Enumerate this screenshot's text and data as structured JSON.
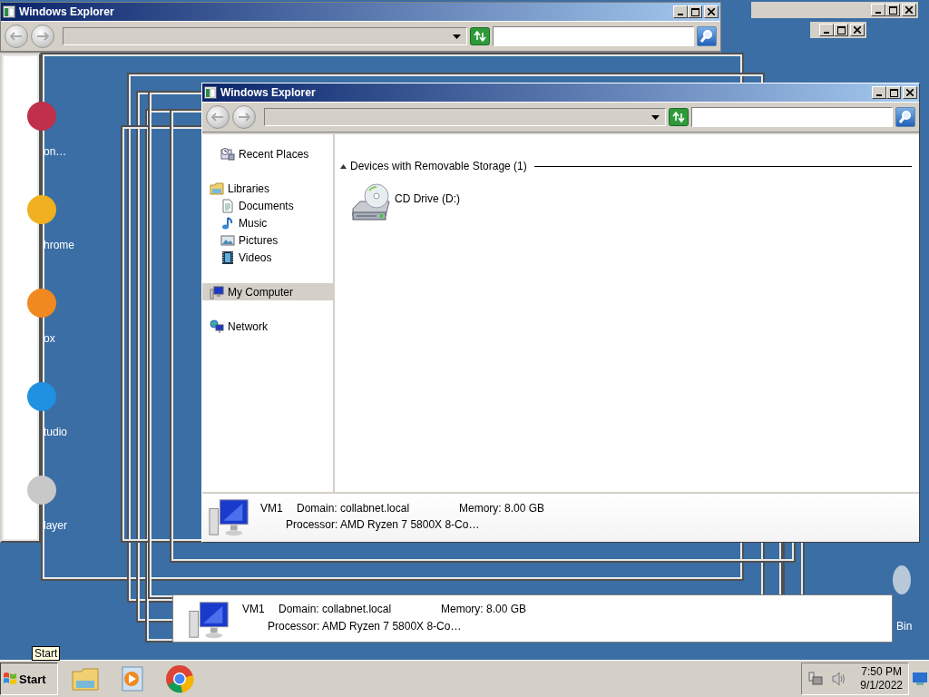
{
  "desktop_icons": [
    {
      "label": "on…",
      "kind": "app"
    },
    {
      "label": "hrome",
      "kind": "chrome"
    },
    {
      "label": "ox",
      "kind": "firefox"
    },
    {
      "label": "tudio",
      "kind": "studio"
    },
    {
      "label": "layer",
      "kind": "player"
    },
    {
      "label": "Bin",
      "kind": "bin"
    }
  ],
  "back_window": {
    "title": "Windows Explorer"
  },
  "ghost_details": {
    "name": "VM1",
    "domain": "Domain: collabnet.local",
    "memory": "Memory: 8.00 GB",
    "processor": "Processor: AMD Ryzen 7 5800X 8-Co…"
  },
  "window": {
    "title": "Windows Explorer",
    "sidebar": {
      "items": [
        {
          "label": "Recent Places",
          "kind": "recent",
          "selected": false
        },
        {
          "label": "Libraries",
          "kind": "libraries",
          "selected": false,
          "children": [
            {
              "label": "Documents",
              "kind": "documents",
              "selected": false
            },
            {
              "label": "Music",
              "kind": "music",
              "selected": false
            },
            {
              "label": "Pictures",
              "kind": "pictures",
              "selected": false
            },
            {
              "label": "Videos",
              "kind": "videos",
              "selected": false
            }
          ]
        },
        {
          "label": "My Computer",
          "kind": "computer",
          "selected": true
        },
        {
          "label": "Network",
          "kind": "network",
          "selected": false
        }
      ]
    },
    "content": {
      "group": "Devices with Removable Storage (1)",
      "expanded": true,
      "items": [
        {
          "label": "CD Drive (D:)",
          "kind": "cd"
        }
      ]
    },
    "details": {
      "name": "VM1",
      "domain": "Domain: collabnet.local",
      "memory": "Memory: 8.00 GB",
      "processor": "Processor: AMD Ryzen 7 5800X 8-Co…"
    }
  },
  "tooltip": "Start",
  "taskbar": {
    "start": "Start",
    "pinned": [
      {
        "kind": "explorer"
      },
      {
        "kind": "media"
      },
      {
        "kind": "chrome"
      }
    ],
    "time": "7:50 PM",
    "date": "9/1/2022"
  }
}
